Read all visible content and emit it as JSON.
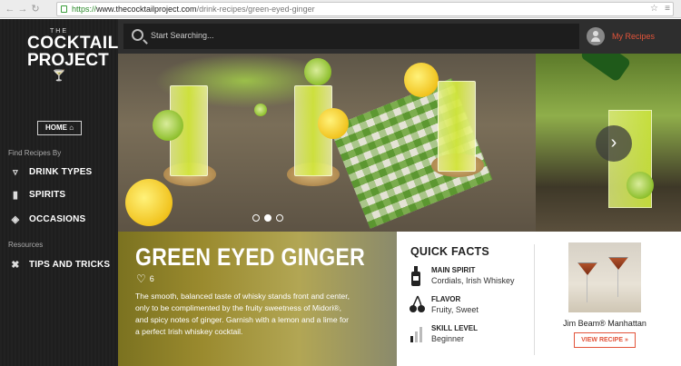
{
  "browser": {
    "url_scheme": "https://",
    "url_host": "www.thecocktailproject.com",
    "url_path": "/drink-recipes/green-eyed-ginger"
  },
  "logo": {
    "the": "THE",
    "word1": "COCKTAIL",
    "word2": "PROJECT"
  },
  "sidebar": {
    "home_label": "HOME",
    "find_label": "Find Recipes By",
    "find_items": [
      {
        "label": "DRINK TYPES",
        "icon": "martini-glass-icon"
      },
      {
        "label": "SPIRITS",
        "icon": "bottle-icon"
      },
      {
        "label": "OCCASIONS",
        "icon": "cheers-icon"
      }
    ],
    "resources_label": "Resources",
    "resource_items": [
      {
        "label": "TIPS AND TRICKS",
        "icon": "tools-icon"
      }
    ]
  },
  "search": {
    "placeholder": "Start Searching..."
  },
  "account": {
    "my_recipes": "My Recipes"
  },
  "hero": {
    "slides": 3,
    "active_slide": 2
  },
  "drink": {
    "title": "GREEN EYED GINGER",
    "likes": "6",
    "description": "The smooth, balanced taste of whisky stands front and center, only to be complimented by the fruity sweetness of Midori®, and spicy notes of ginger. Garnish with a lemon and a lime for a perfect Irish whiskey cocktail."
  },
  "facts": {
    "heading": "QUICK FACTS",
    "items": [
      {
        "label": "MAIN SPIRIT",
        "value": "Cordials, Irish Whiskey",
        "icon": "bottle-icon"
      },
      {
        "label": "FLAVOR",
        "value": "Fruity, Sweet",
        "icon": "cherries-icon"
      },
      {
        "label": "SKILL LEVEL",
        "value": "Beginner",
        "icon": "skill-bars-icon"
      }
    ]
  },
  "related": {
    "name": "Jim Beam® Manhattan",
    "button": "VIEW RECIPE »"
  },
  "colors": {
    "accent": "#e2543a",
    "sidebar": "#1e1e1e",
    "topbar": "#2e2e2e"
  }
}
